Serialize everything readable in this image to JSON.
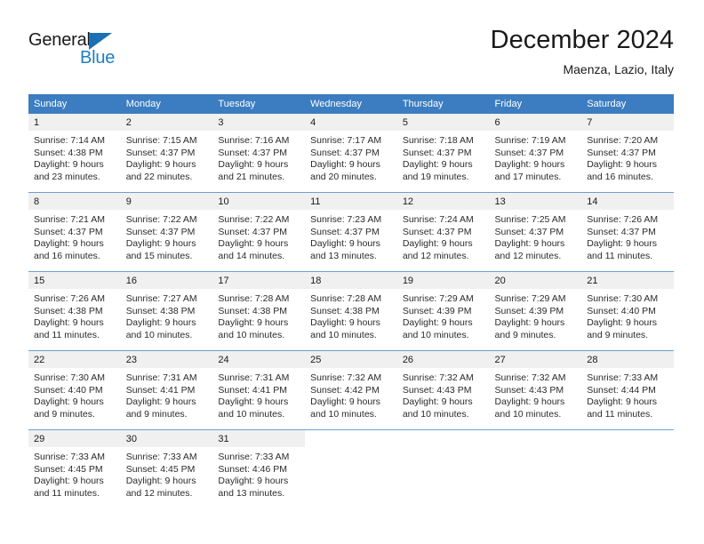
{
  "brand": {
    "line1": "General",
    "line2": "Blue",
    "triangle_color": "#1b6fb5",
    "blue_text_color": "#1f7ec4"
  },
  "header": {
    "title": "December 2024",
    "location": "Maenza, Lazio, Italy"
  },
  "theme": {
    "header_blue": "#3b7dc0",
    "daynum_bg": "#f0f0f0",
    "row_divider": "#6f9fd0"
  },
  "weekday_headers": [
    "Sunday",
    "Monday",
    "Tuesday",
    "Wednesday",
    "Thursday",
    "Friday",
    "Saturday"
  ],
  "weeks": [
    [
      {
        "day": "1",
        "sunrise": "Sunrise: 7:14 AM",
        "sunset": "Sunset: 4:38 PM",
        "daylight1": "Daylight: 9 hours",
        "daylight2": "and 23 minutes."
      },
      {
        "day": "2",
        "sunrise": "Sunrise: 7:15 AM",
        "sunset": "Sunset: 4:37 PM",
        "daylight1": "Daylight: 9 hours",
        "daylight2": "and 22 minutes."
      },
      {
        "day": "3",
        "sunrise": "Sunrise: 7:16 AM",
        "sunset": "Sunset: 4:37 PM",
        "daylight1": "Daylight: 9 hours",
        "daylight2": "and 21 minutes."
      },
      {
        "day": "4",
        "sunrise": "Sunrise: 7:17 AM",
        "sunset": "Sunset: 4:37 PM",
        "daylight1": "Daylight: 9 hours",
        "daylight2": "and 20 minutes."
      },
      {
        "day": "5",
        "sunrise": "Sunrise: 7:18 AM",
        "sunset": "Sunset: 4:37 PM",
        "daylight1": "Daylight: 9 hours",
        "daylight2": "and 19 minutes."
      },
      {
        "day": "6",
        "sunrise": "Sunrise: 7:19 AM",
        "sunset": "Sunset: 4:37 PM",
        "daylight1": "Daylight: 9 hours",
        "daylight2": "and 17 minutes."
      },
      {
        "day": "7",
        "sunrise": "Sunrise: 7:20 AM",
        "sunset": "Sunset: 4:37 PM",
        "daylight1": "Daylight: 9 hours",
        "daylight2": "and 16 minutes."
      }
    ],
    [
      {
        "day": "8",
        "sunrise": "Sunrise: 7:21 AM",
        "sunset": "Sunset: 4:37 PM",
        "daylight1": "Daylight: 9 hours",
        "daylight2": "and 16 minutes."
      },
      {
        "day": "9",
        "sunrise": "Sunrise: 7:22 AM",
        "sunset": "Sunset: 4:37 PM",
        "daylight1": "Daylight: 9 hours",
        "daylight2": "and 15 minutes."
      },
      {
        "day": "10",
        "sunrise": "Sunrise: 7:22 AM",
        "sunset": "Sunset: 4:37 PM",
        "daylight1": "Daylight: 9 hours",
        "daylight2": "and 14 minutes."
      },
      {
        "day": "11",
        "sunrise": "Sunrise: 7:23 AM",
        "sunset": "Sunset: 4:37 PM",
        "daylight1": "Daylight: 9 hours",
        "daylight2": "and 13 minutes."
      },
      {
        "day": "12",
        "sunrise": "Sunrise: 7:24 AM",
        "sunset": "Sunset: 4:37 PM",
        "daylight1": "Daylight: 9 hours",
        "daylight2": "and 12 minutes."
      },
      {
        "day": "13",
        "sunrise": "Sunrise: 7:25 AM",
        "sunset": "Sunset: 4:37 PM",
        "daylight1": "Daylight: 9 hours",
        "daylight2": "and 12 minutes."
      },
      {
        "day": "14",
        "sunrise": "Sunrise: 7:26 AM",
        "sunset": "Sunset: 4:37 PM",
        "daylight1": "Daylight: 9 hours",
        "daylight2": "and 11 minutes."
      }
    ],
    [
      {
        "day": "15",
        "sunrise": "Sunrise: 7:26 AM",
        "sunset": "Sunset: 4:38 PM",
        "daylight1": "Daylight: 9 hours",
        "daylight2": "and 11 minutes."
      },
      {
        "day": "16",
        "sunrise": "Sunrise: 7:27 AM",
        "sunset": "Sunset: 4:38 PM",
        "daylight1": "Daylight: 9 hours",
        "daylight2": "and 10 minutes."
      },
      {
        "day": "17",
        "sunrise": "Sunrise: 7:28 AM",
        "sunset": "Sunset: 4:38 PM",
        "daylight1": "Daylight: 9 hours",
        "daylight2": "and 10 minutes."
      },
      {
        "day": "18",
        "sunrise": "Sunrise: 7:28 AM",
        "sunset": "Sunset: 4:38 PM",
        "daylight1": "Daylight: 9 hours",
        "daylight2": "and 10 minutes."
      },
      {
        "day": "19",
        "sunrise": "Sunrise: 7:29 AM",
        "sunset": "Sunset: 4:39 PM",
        "daylight1": "Daylight: 9 hours",
        "daylight2": "and 10 minutes."
      },
      {
        "day": "20",
        "sunrise": "Sunrise: 7:29 AM",
        "sunset": "Sunset: 4:39 PM",
        "daylight1": "Daylight: 9 hours",
        "daylight2": "and 9 minutes."
      },
      {
        "day": "21",
        "sunrise": "Sunrise: 7:30 AM",
        "sunset": "Sunset: 4:40 PM",
        "daylight1": "Daylight: 9 hours",
        "daylight2": "and 9 minutes."
      }
    ],
    [
      {
        "day": "22",
        "sunrise": "Sunrise: 7:30 AM",
        "sunset": "Sunset: 4:40 PM",
        "daylight1": "Daylight: 9 hours",
        "daylight2": "and 9 minutes."
      },
      {
        "day": "23",
        "sunrise": "Sunrise: 7:31 AM",
        "sunset": "Sunset: 4:41 PM",
        "daylight1": "Daylight: 9 hours",
        "daylight2": "and 9 minutes."
      },
      {
        "day": "24",
        "sunrise": "Sunrise: 7:31 AM",
        "sunset": "Sunset: 4:41 PM",
        "daylight1": "Daylight: 9 hours",
        "daylight2": "and 10 minutes."
      },
      {
        "day": "25",
        "sunrise": "Sunrise: 7:32 AM",
        "sunset": "Sunset: 4:42 PM",
        "daylight1": "Daylight: 9 hours",
        "daylight2": "and 10 minutes."
      },
      {
        "day": "26",
        "sunrise": "Sunrise: 7:32 AM",
        "sunset": "Sunset: 4:43 PM",
        "daylight1": "Daylight: 9 hours",
        "daylight2": "and 10 minutes."
      },
      {
        "day": "27",
        "sunrise": "Sunrise: 7:32 AM",
        "sunset": "Sunset: 4:43 PM",
        "daylight1": "Daylight: 9 hours",
        "daylight2": "and 10 minutes."
      },
      {
        "day": "28",
        "sunrise": "Sunrise: 7:33 AM",
        "sunset": "Sunset: 4:44 PM",
        "daylight1": "Daylight: 9 hours",
        "daylight2": "and 11 minutes."
      }
    ],
    [
      {
        "day": "29",
        "sunrise": "Sunrise: 7:33 AM",
        "sunset": "Sunset: 4:45 PM",
        "daylight1": "Daylight: 9 hours",
        "daylight2": "and 11 minutes."
      },
      {
        "day": "30",
        "sunrise": "Sunrise: 7:33 AM",
        "sunset": "Sunset: 4:45 PM",
        "daylight1": "Daylight: 9 hours",
        "daylight2": "and 12 minutes."
      },
      {
        "day": "31",
        "sunrise": "Sunrise: 7:33 AM",
        "sunset": "Sunset: 4:46 PM",
        "daylight1": "Daylight: 9 hours",
        "daylight2": "and 13 minutes."
      },
      {
        "day": "",
        "sunrise": "",
        "sunset": "",
        "daylight1": "",
        "daylight2": ""
      },
      {
        "day": "",
        "sunrise": "",
        "sunset": "",
        "daylight1": "",
        "daylight2": ""
      },
      {
        "day": "",
        "sunrise": "",
        "sunset": "",
        "daylight1": "",
        "daylight2": ""
      },
      {
        "day": "",
        "sunrise": "",
        "sunset": "",
        "daylight1": "",
        "daylight2": ""
      }
    ]
  ]
}
